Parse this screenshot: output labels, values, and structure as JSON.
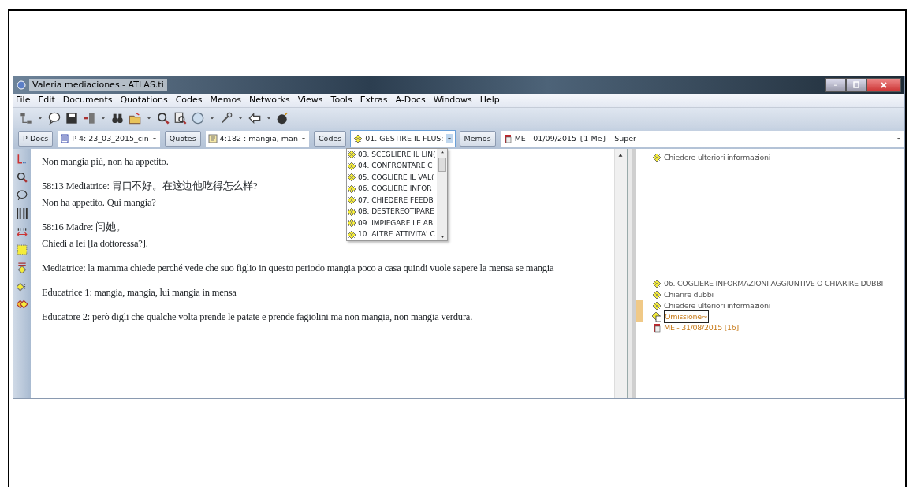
{
  "window": {
    "title": "Valeria mediaciones - ATLAS.ti"
  },
  "menu": [
    "File",
    "Edit",
    "Documents",
    "Quotations",
    "Codes",
    "Memos",
    "Networks",
    "Views",
    "Tools",
    "Extras",
    "A-Docs",
    "Windows",
    "Help"
  ],
  "selectors": [
    {
      "label": "P-Docs",
      "value": "P 4: 23_03_2015_cin",
      "kind": "doc"
    },
    {
      "label": "Quotes",
      "value": "4:182 : mangia, man",
      "kind": "quote"
    },
    {
      "label": "Codes",
      "value": "01. GESTIRE IL FLUS:",
      "kind": "code",
      "expanded": true
    },
    {
      "label": "Memos",
      "value": "ME - 01/09/2015 {1-Me} - Super",
      "kind": "memo"
    }
  ],
  "code_dropdown": [
    "03. SCEGLIERE IL LIN(",
    "04. CONFRONTARE C",
    "05. COGLIERE IL VAL(",
    "06. COGLIERE INFOR",
    "07. CHIEDERE FEEDB",
    "08. DESTEREOTIPARE",
    "09. IMPIEGARE LE AB",
    "10. ALTRE ATTIVITA' C"
  ],
  "document": [
    [
      "Non mangia più, non ha appetito."
    ],
    [
      "58:13 Mediatrice: 胃口不好。在这边他吃得怎么样?",
      "Non ha appetito. Qui mangia?"
    ],
    [
      "58:16 Madre: 问她。",
      "Chiedi a lei [la dottoressa?]."
    ],
    [
      "Mediatrice: la mamma chiede perché vede che suo figlio in questo periodo mangia poco a casa quindi vuole sapere la mensa se mangia"
    ],
    [
      "Educatrice 1: mangia, mangia, lui mangia in mensa"
    ],
    [
      "Educatore 2: però digli che qualche volta prende le patate e prende fagiolini ma  non mangia, non mangia verdura."
    ]
  ],
  "margin_top": [
    {
      "kind": "code",
      "label": "Chiedere ulteriori informazioni",
      "selected": false,
      "highlighted": false
    }
  ],
  "margin": [
    {
      "kind": "code",
      "label": "06. COGLIERE INFORMAZIONI AGGIUNTIVE O CHIARIRE DUBBI",
      "selected": false,
      "highlighted": false
    },
    {
      "kind": "code",
      "label": "Chiarire dubbi",
      "selected": false,
      "highlighted": false
    },
    {
      "kind": "code",
      "label": "Chiedere ulteriori informazioni",
      "selected": false,
      "highlighted": true
    },
    {
      "kind": "code-memo",
      "label": "Omissione~",
      "selected": true,
      "highlighted": true
    },
    {
      "kind": "memo",
      "label": "ME - 31/08/2015 [16]",
      "selected": false,
      "highlighted": false
    }
  ]
}
